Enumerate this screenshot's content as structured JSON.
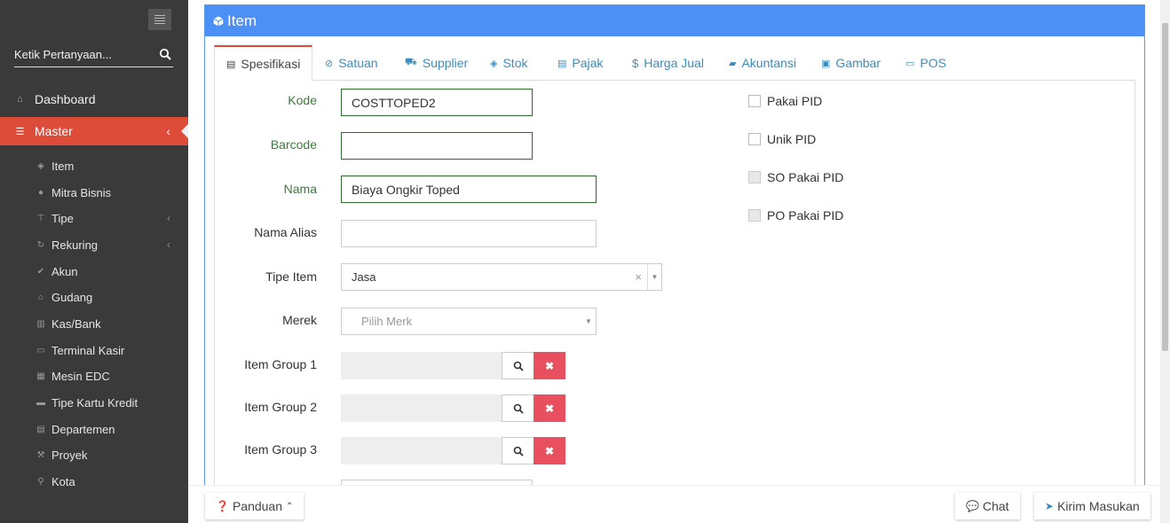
{
  "sidebar": {
    "search_placeholder": "Ketik Pertanyaan...",
    "nav": [
      {
        "label": "Dashboard",
        "icon": "home-icon"
      },
      {
        "label": "Master",
        "icon": "database-icon"
      }
    ],
    "sub": [
      {
        "label": "Item",
        "icon": "cube-icon",
        "chev": ""
      },
      {
        "label": "Mitra Bisnis",
        "icon": "users-icon",
        "chev": ""
      },
      {
        "label": "Tipe",
        "icon": "sitemap-icon",
        "chev": "‹"
      },
      {
        "label": "Rekuring",
        "icon": "refresh-icon",
        "chev": "‹"
      },
      {
        "label": "Akun",
        "icon": "check-icon",
        "chev": ""
      },
      {
        "label": "Gudang",
        "icon": "home-icon",
        "chev": ""
      },
      {
        "label": "Kas/Bank",
        "icon": "bank-icon",
        "chev": ""
      },
      {
        "label": "Terminal Kasir",
        "icon": "desktop-icon",
        "chev": ""
      },
      {
        "label": "Mesin EDC",
        "icon": "calculator-icon",
        "chev": ""
      },
      {
        "label": "Tipe Kartu Kredit",
        "icon": "credit-card-icon",
        "chev": ""
      },
      {
        "label": "Departemen",
        "icon": "building-icon",
        "chev": ""
      },
      {
        "label": "Proyek",
        "icon": "gavel-icon",
        "chev": ""
      },
      {
        "label": "Kota",
        "icon": "map-marker-icon",
        "chev": ""
      }
    ]
  },
  "box": {
    "title": "Item"
  },
  "tabs": [
    {
      "label": "Spesifikasi",
      "glyph": "▤"
    },
    {
      "label": "Satuan",
      "glyph": "⊘"
    },
    {
      "label": "Supplier",
      "glyph": "⛟"
    },
    {
      "label": "Stok",
      "glyph": "◈"
    },
    {
      "label": "Pajak",
      "glyph": "▤"
    },
    {
      "label": "Harga Jual",
      "glyph": "$"
    },
    {
      "label": "Akuntansi",
      "glyph": "▰"
    },
    {
      "label": "Gambar",
      "glyph": "▣"
    },
    {
      "label": "POS",
      "glyph": "▭"
    }
  ],
  "form": {
    "kode_label": "Kode",
    "kode_value": "COSTTOPED2",
    "barcode_label": "Barcode",
    "barcode_value": "",
    "nama_label": "Nama",
    "nama_value": "Biaya Ongkir Toped",
    "alias_label": "Nama Alias",
    "alias_value": "",
    "tipe_label": "Tipe Item",
    "tipe_value": "Jasa",
    "merek_label": "Merek",
    "merek_placeholder": "Pilih Merk",
    "group1_label": "Item Group 1",
    "group2_label": "Item Group 2",
    "group3_label": "Item Group 3"
  },
  "checks": {
    "pakai_pid": "Pakai PID",
    "unik_pid": "Unik PID",
    "so_pakai_pid": "SO Pakai PID",
    "po_pakai_pid": "PO Pakai PID"
  },
  "footer": {
    "panduan": "Panduan",
    "chat": "Chat",
    "kirim": "Kirim Masukan"
  }
}
